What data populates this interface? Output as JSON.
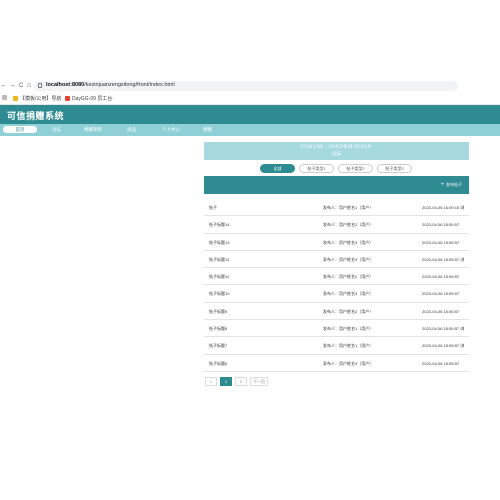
{
  "browser": {
    "nav_back": "←",
    "nav_forward": "→",
    "nav_reload": "C",
    "nav_home": "⌂",
    "url_host": "localhost:8080",
    "url_path": "/kexinjuanzengxitong/front/index.html",
    "bookmarks": [
      {
        "label": "【模板/公用】导航",
        "color": "#f3b520"
      },
      {
        "label": "DayGG·09 员工台·",
        "color": "#e94235"
      }
    ]
  },
  "app": {
    "title": "可信捐赠系统",
    "nav": [
      {
        "label": "首页",
        "active": true
      },
      {
        "label": "论坛"
      },
      {
        "label": "捐赠项目"
      },
      {
        "label": "商品"
      },
      {
        "label": "个人中心"
      },
      {
        "label": "捐赠"
      }
    ]
  },
  "forum": {
    "banner_en": "FORUM / INFORMATION",
    "banner_cn": "论坛",
    "tabs": [
      {
        "label": "全部",
        "active": true
      },
      {
        "label": "帖子类型1"
      },
      {
        "label": "帖子类型2"
      },
      {
        "label": "帖子类型3"
      }
    ],
    "post_button": "发布帖子",
    "posts": [
      {
        "title": "帖子",
        "author": "发布人：用户姓名1（用户）",
        "time": "2023-04-06 16:09:15 浏"
      },
      {
        "title": "帖子标题14",
        "author": "发布人：用户姓名2（用户）",
        "time": "2023-04-06 15:55:57"
      },
      {
        "title": "帖子标题13",
        "author": "发布人：用户姓名3（用户）",
        "time": "2023-04-06 15:55:57"
      },
      {
        "title": "帖子标题12",
        "author": "发布人：用户姓名3（用户）",
        "time": "2023-04-06 15:55:57 浏"
      },
      {
        "title": "帖子标题11",
        "author": "发布人：用户姓名2（用户）",
        "time": "2023-04-06 15:55:57"
      },
      {
        "title": "帖子标题10",
        "author": "发布人：用户姓名3（用户）",
        "time": "2023-04-06 15:55:57"
      },
      {
        "title": "帖子标题9",
        "author": "发布人：用户姓名2（用户）",
        "time": "2023-04-06 15:55:57"
      },
      {
        "title": "帖子标题8",
        "author": "发布人：用户姓名1（用户）",
        "time": "2023-04-06 15:55:57 浏"
      },
      {
        "title": "帖子标题7",
        "author": "发布人：用户姓名1（用户）",
        "time": "2023-04-06 15:55:57 浏"
      },
      {
        "title": "帖子标题6",
        "author": "发布人：用户姓名3（用户）",
        "time": "2023-04-06 15:55:57"
      }
    ],
    "pagination": {
      "prev": "<",
      "pages": [
        "1",
        "2"
      ],
      "current": "1",
      "next": "下一页"
    }
  }
}
